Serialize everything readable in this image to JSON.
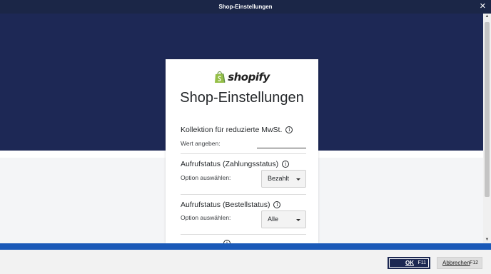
{
  "window": {
    "title": "Shop-Einstellungen",
    "close_symbol": "✕"
  },
  "logo": {
    "brand": "shopify",
    "icon": "shopify-bag-icon",
    "brand_color": "#95bf47"
  },
  "card": {
    "title": "Shop-Einstellungen",
    "sections": [
      {
        "title": "Kollektion für reduzierte MwSt.",
        "label": "Wert angeben:",
        "value": ""
      },
      {
        "title": "Aufrufstatus (Zahlungsstatus)",
        "label": "Option auswählen:",
        "value": "Bezahlt"
      },
      {
        "title": "Aufrufstatus (Bestellstatus)",
        "label": "Option auswählen:",
        "value": "Alle"
      }
    ],
    "info_symbol": "i"
  },
  "footer": {
    "ok_label": "OK",
    "ok_key": "F11",
    "cancel_label": "Abbrechen",
    "cancel_key": "F12"
  },
  "colors": {
    "titlebar": "#1b2647",
    "header_bg": "#1d2855",
    "accent_bar": "#1a59b8",
    "ok_button": "#1c2852"
  }
}
